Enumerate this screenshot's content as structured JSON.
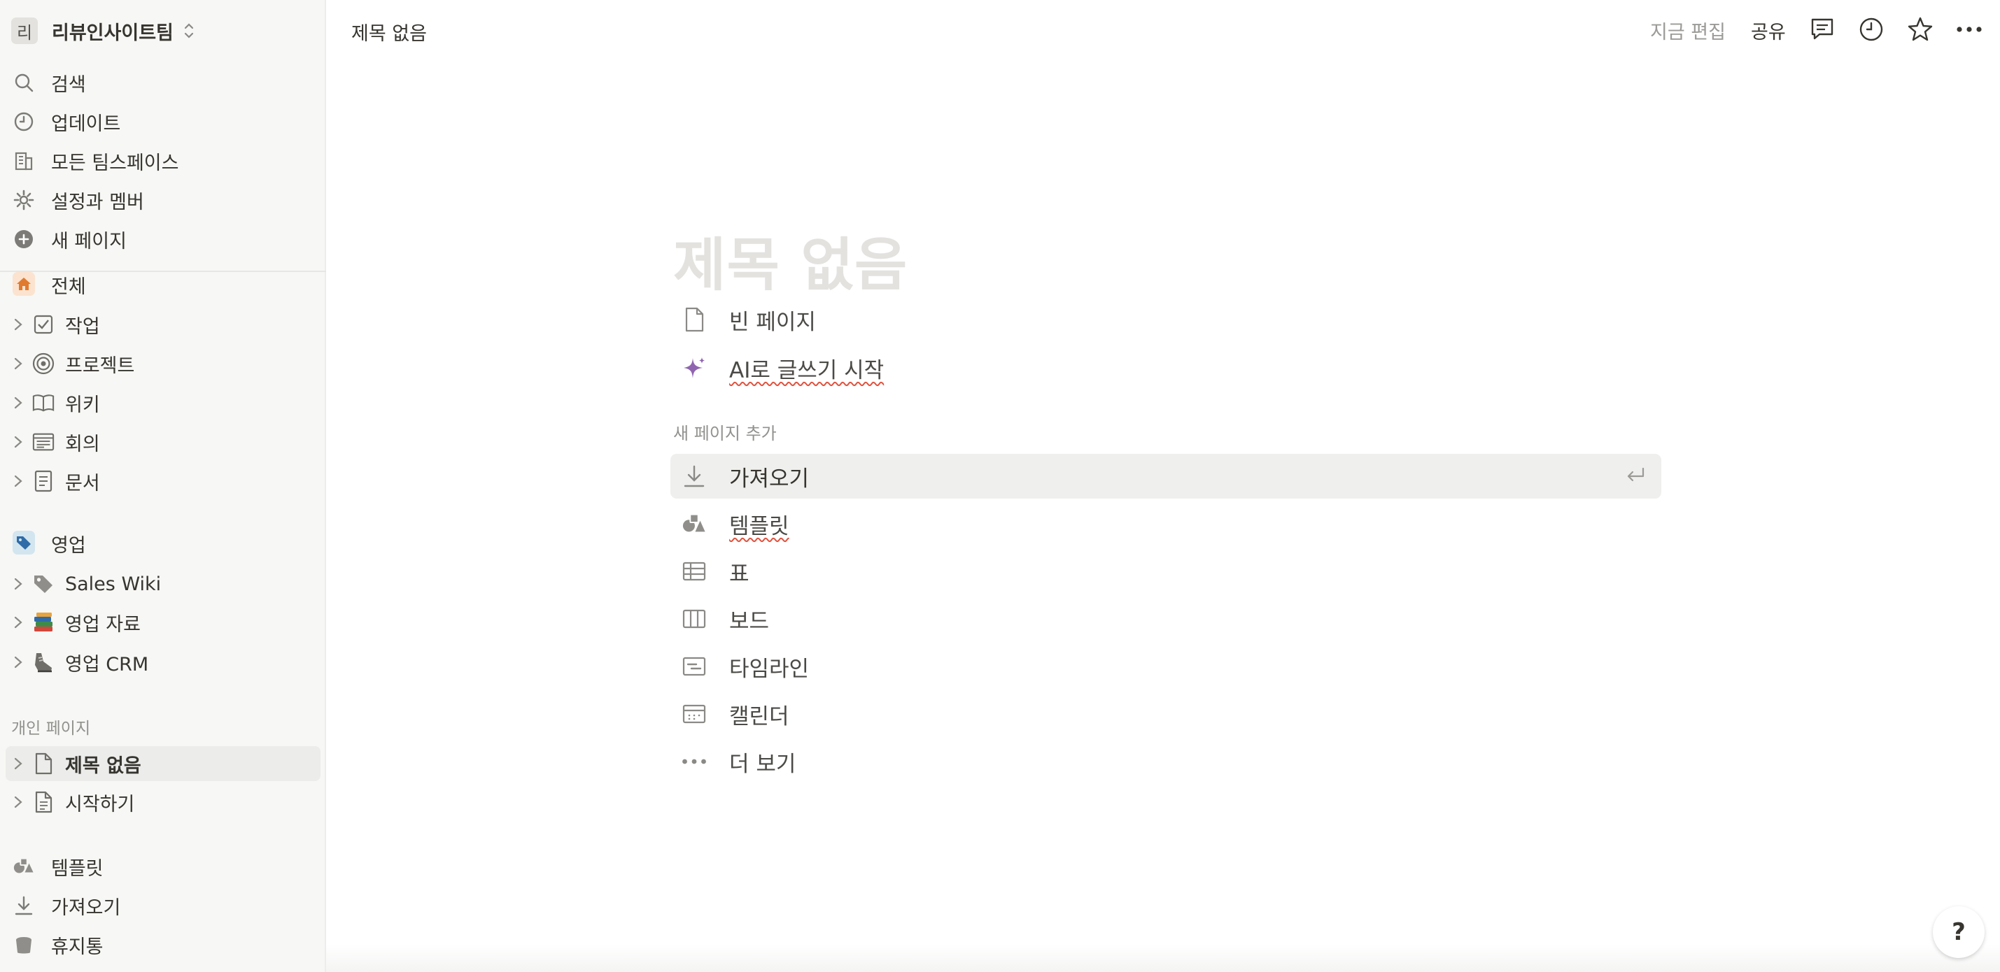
{
  "workspace": {
    "avatar_letter": "리",
    "name": "리뷰인사이트팀"
  },
  "sidebar": {
    "nav": [
      {
        "label": "검색",
        "icon": "search-icon"
      },
      {
        "label": "업데이트",
        "icon": "clock-icon"
      },
      {
        "label": "모든 팀스페이스",
        "icon": "building-icon"
      },
      {
        "label": "설정과 멤버",
        "icon": "gear-icon"
      },
      {
        "label": "새 페이지",
        "icon": "plus-circle-icon"
      }
    ],
    "teamspace_all": {
      "label": "전체",
      "icon": "home-icon",
      "color": "#f4a261"
    },
    "all_items": [
      {
        "label": "작업",
        "icon": "checkbox-icon"
      },
      {
        "label": "프로젝트",
        "icon": "target-icon"
      },
      {
        "label": "위키",
        "icon": "book-icon"
      },
      {
        "label": "회의",
        "icon": "meeting-notes-icon"
      },
      {
        "label": "문서",
        "icon": "document-icon"
      }
    ],
    "teamspace_sales": {
      "label": "영업",
      "icon": "tag-icon",
      "color": "#3f7fc0"
    },
    "sales_items": [
      {
        "label": "Sales Wiki",
        "icon": "tag-icon"
      },
      {
        "label": "영업 자료",
        "icon": "books-icon"
      },
      {
        "label": "영업 CRM",
        "icon": "shoe-icon"
      }
    ],
    "private_label": "개인 페이지",
    "private_items": [
      {
        "label": "제목 없음",
        "icon": "page-icon"
      },
      {
        "label": "시작하기",
        "icon": "page-text-icon"
      }
    ],
    "footer": [
      {
        "label": "템플릿",
        "icon": "shapes-icon"
      },
      {
        "label": "가져오기",
        "icon": "download-icon"
      },
      {
        "label": "휴지통",
        "icon": "trash-icon"
      }
    ]
  },
  "topbar": {
    "title": "제목 없음",
    "edited": "지금 편집",
    "share": "공유"
  },
  "main": {
    "title_placeholder": "제목 없음",
    "quick": [
      {
        "label": "빈 페이지",
        "icon": "page-icon"
      },
      {
        "label": "AI로 글쓰기 시작",
        "icon": "sparkle-icon",
        "accent": "#9065b0"
      }
    ],
    "new_page_label": "새 페이지 추가",
    "options": [
      {
        "label": "가져오기",
        "icon": "download-icon"
      },
      {
        "label": "템플릿",
        "icon": "shapes-icon"
      },
      {
        "label": "표",
        "icon": "table-icon"
      },
      {
        "label": "보드",
        "icon": "board-icon"
      },
      {
        "label": "타임라인",
        "icon": "timeline-icon"
      },
      {
        "label": "캘린더",
        "icon": "calendar-icon"
      },
      {
        "label": "더 보기",
        "icon": "more-icon"
      }
    ]
  },
  "help_label": "?"
}
